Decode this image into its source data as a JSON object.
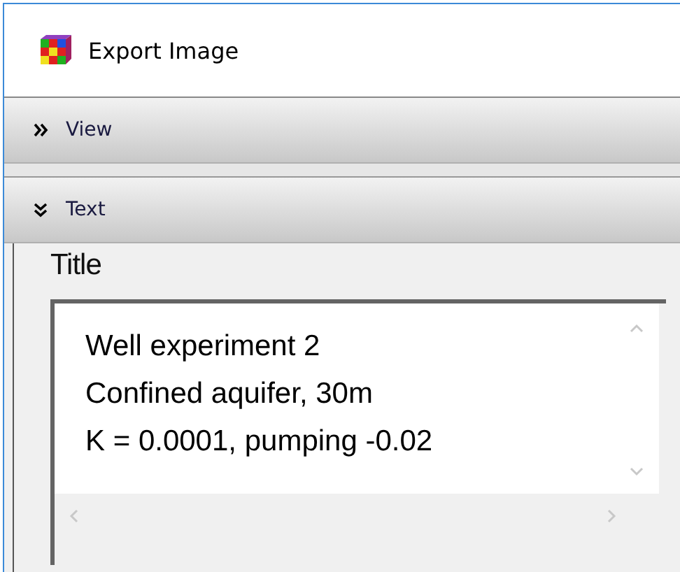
{
  "window": {
    "title": "Export Image"
  },
  "sections": [
    {
      "label": "View",
      "expanded": false
    },
    {
      "label": "Text",
      "expanded": true
    }
  ],
  "title_field": {
    "label": "Title",
    "value": [
      "Well experiment 2",
      "Confined aquifer, 30m",
      "K = 0.0001, pumping -0.02"
    ]
  }
}
